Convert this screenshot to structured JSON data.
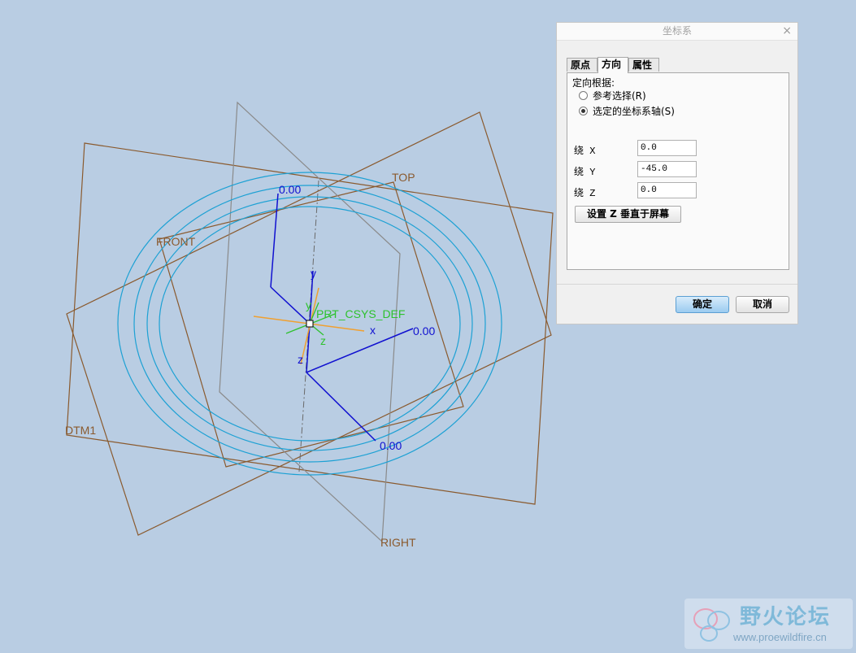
{
  "viewport": {
    "plane_labels": {
      "top": "TOP",
      "front": "FRONT",
      "right": "RIGHT",
      "dtm1": "DTM1"
    },
    "csys_label": "PRT_CSYS_DEF",
    "axis_letters": {
      "y_upper": "y",
      "y_small": "y",
      "x": "x",
      "z_small": "z",
      "z": "z"
    },
    "drag_values": {
      "top": "0.00",
      "right": "0.00",
      "bottom": "0.00"
    },
    "colors": {
      "background": "#b9cde3",
      "datum_plane": "#8a5a2e",
      "sketch_circles": "#1da1d4",
      "drag_handles": "#1010d0",
      "csys_label": "#2ec22e"
    }
  },
  "dialog": {
    "title": "坐标系",
    "close_icon": "close-icon",
    "tabs": [
      "原点",
      "方向",
      "属性"
    ],
    "active_tab": "方向",
    "orient_by_label": "定向根据:",
    "radio_reference": "参考选择(R)",
    "radio_selected_axes": "选定的坐标系轴(S)",
    "selected_option": "选定的坐标系轴(S)",
    "rot_x_label": "绕 X",
    "rot_x_value": "0.0",
    "rot_y_label": "绕 Y",
    "rot_y_value": "-45.0",
    "rot_z_label": "绕 Z",
    "rot_z_value": "0.0",
    "set_z_button": "设置 Z 垂直于屏幕",
    "ok_button": "确定",
    "cancel_button": "取消"
  },
  "watermark": {
    "title": "野火论坛",
    "url": "www.proewildfire.cn"
  }
}
